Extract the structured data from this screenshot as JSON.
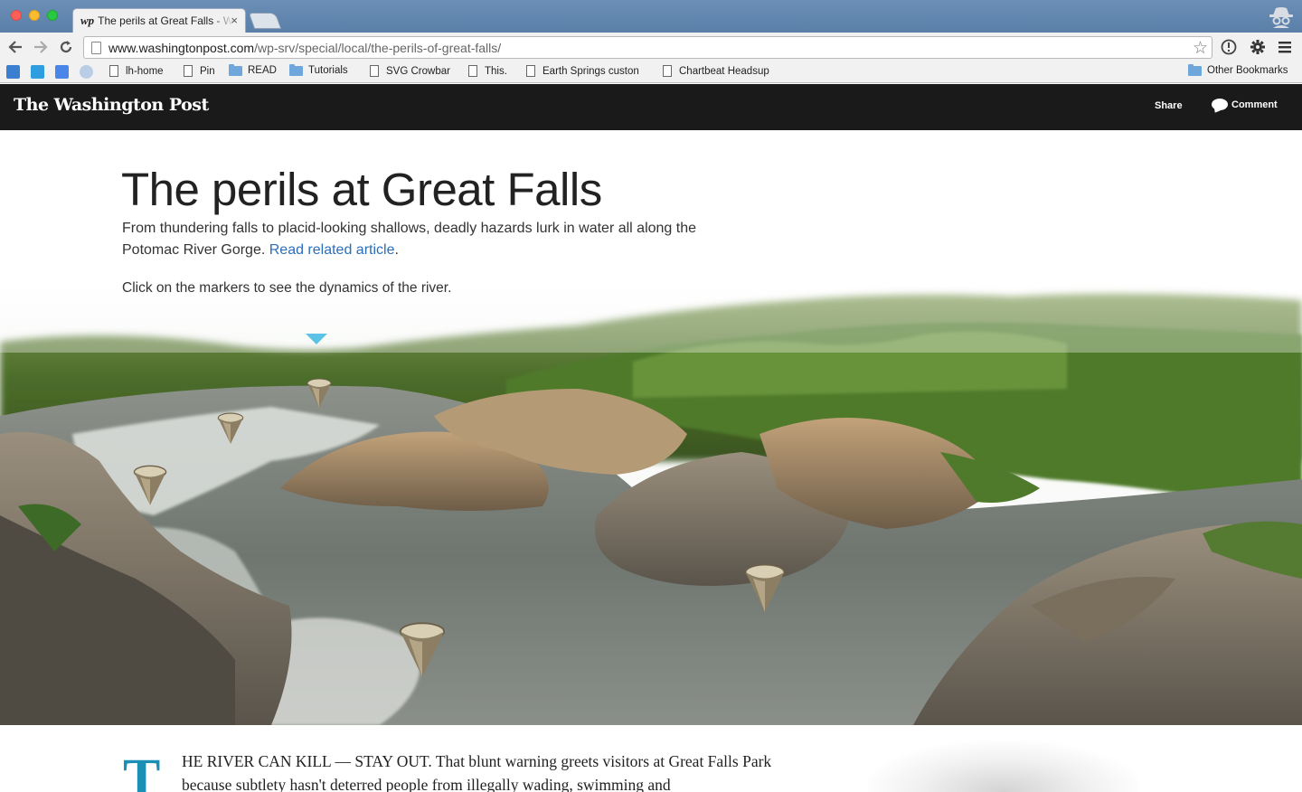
{
  "browser": {
    "tab_title": "The perils at Great Falls - Washington Post",
    "tab_favicon": "wp",
    "tab_close": "×",
    "url_host": "www.washingtonpost.com",
    "url_path": "/wp-srv/special/local/the-perils-of-great-falls/",
    "bookmarks": [
      {
        "label": "lh-home",
        "icon": "page-icon"
      },
      {
        "label": "Pin",
        "icon": "page-icon"
      },
      {
        "label": "READ",
        "icon": "folder-icon"
      },
      {
        "label": "Tutorials",
        "icon": "folder-icon"
      },
      {
        "label": "SVG Crowbar",
        "icon": "page-icon"
      },
      {
        "label": "This.",
        "icon": "page-icon"
      },
      {
        "label": "Earth Springs custon",
        "icon": "page-icon"
      },
      {
        "label": "Chartbeat Headsup",
        "icon": "page-icon"
      }
    ],
    "other_bookmarks": "Other Bookmarks"
  },
  "header": {
    "logo": "The Washington Post",
    "share": "Share",
    "comment": "Comment"
  },
  "article": {
    "headline": "The perils at Great Falls",
    "dek": "From thundering falls to placid-looking shallows, deadly hazards lurk in water all along the Potomac River Gorge.",
    "related_link": "Read related article",
    "dek_end": ".",
    "instructions": "Click on the markers to see the dynamics of the river.",
    "dropcap": "T",
    "body_lead": "HE RIVER CAN KILL — STAY OUT. That blunt warning greets visitors at Great Falls Park because subtlety hasn't deterred people from illegally wading, swimming and"
  },
  "colors": {
    "header_bg": "#1a1a1a",
    "link": "#2a6ebb",
    "dropcap": "#1c90b4",
    "indicator": "#5cc3e6"
  },
  "icons": [
    "back-arrow-icon",
    "forward-arrow-icon",
    "reload-icon",
    "star-icon",
    "info-icon",
    "gear-icon",
    "menu-icon",
    "incognito-icon",
    "comment-bubble-icon",
    "map-marker-icon"
  ]
}
